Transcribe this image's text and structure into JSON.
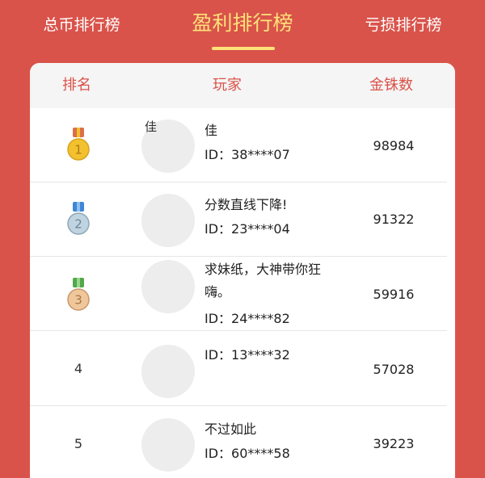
{
  "tabs": {
    "left": "总币排行榜",
    "active": "盈利排行榜",
    "right": "亏损排行榜"
  },
  "header": {
    "rank": "排名",
    "player": "玩家",
    "coins": "金铢数"
  },
  "rows": [
    {
      "rank": "1",
      "nickname": "佳",
      "id": "ID：38****07",
      "coins": "98984",
      "avatar_text": "佳"
    },
    {
      "rank": "2",
      "nickname": "分数直线下降!",
      "id": "ID：23****04",
      "coins": "91322"
    },
    {
      "rank": "3",
      "nickname": "求妹纸，大神带你狂嗨。",
      "id": "ID：24****82",
      "coins": "59916"
    },
    {
      "rank": "4",
      "nickname": "",
      "id": "ID：13****32",
      "coins": "57028"
    },
    {
      "rank": "5",
      "nickname": "不过如此",
      "id": "ID：60****58",
      "coins": "39223"
    }
  ],
  "colors": {
    "background": "#D9534A",
    "active_tab": "#FFE27A",
    "header_text": "#D9534A",
    "medal_gold": "#F2C12E",
    "medal_silver": "#BFD3E0",
    "medal_bronze": "#F0C79A"
  },
  "icons": {
    "medal_1": "gold-medal-icon",
    "medal_2": "silver-medal-icon",
    "medal_3": "bronze-medal-icon"
  }
}
